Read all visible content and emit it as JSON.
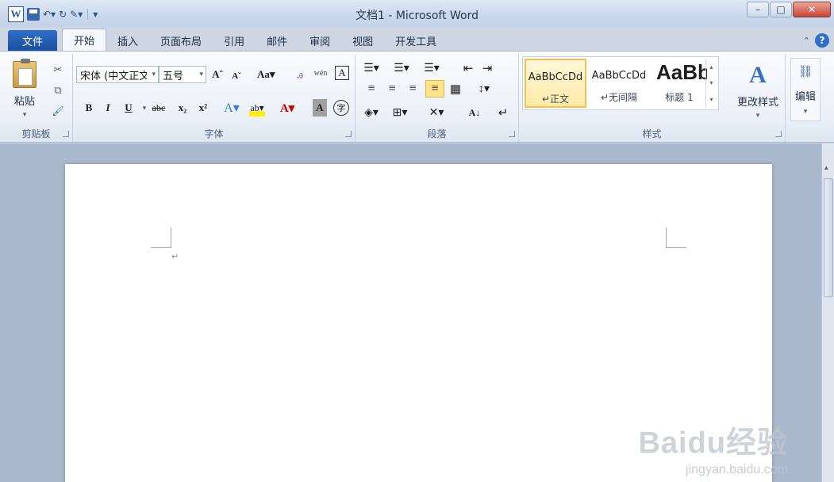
{
  "window": {
    "title": "文档1 - Microsoft Word",
    "minimize": "–",
    "maximize": "□",
    "close": "✕"
  },
  "qat": {
    "app_icon": "W",
    "undo": "↶▾",
    "redo": "↻",
    "format_painter": "✎▾",
    "customize": "▾"
  },
  "tabs": [
    {
      "label": "文件"
    },
    {
      "label": "开始"
    },
    {
      "label": "插入"
    },
    {
      "label": "页面布局"
    },
    {
      "label": "引用"
    },
    {
      "label": "邮件"
    },
    {
      "label": "审阅"
    },
    {
      "label": "视图"
    },
    {
      "label": "开发工具"
    }
  ],
  "ribbon": {
    "clipboard": {
      "label": "剪贴板",
      "paste": "粘贴",
      "paste_arrow": "▾",
      "cut_icon": "✂",
      "copy_icon": "⧉",
      "painter_icon": "🖌"
    },
    "font": {
      "label": "字体",
      "font_name": "宋体 (中文正文",
      "font_size": "五号",
      "grow": "Aˆ",
      "shrink": "Aˇ",
      "change_case": "Aa▾",
      "clear": "ꭿ",
      "phonetic": "wén",
      "border_char": "A",
      "bold": "B",
      "italic": "I",
      "underline": "U",
      "underline_arrow": "▾",
      "strike": "abc",
      "subscript": "x₂",
      "superscript": "x²",
      "effects": "A▾",
      "highlight": "ab▾",
      "font_color": "A▾",
      "shading_char": "A",
      "enclose": "字"
    },
    "paragraph": {
      "label": "段落",
      "bullets": "☰▾",
      "numbering": "☰▾",
      "multilevel": "☰▾",
      "decrease_indent": "⇤",
      "increase_indent": "⇥",
      "align_left": "≡",
      "center": "≡",
      "align_right": "≡",
      "justify": "≡",
      "distributed": "▦",
      "line_spacing": "↕▾",
      "shading": "◈▾",
      "borders": "⊞▾",
      "chinese_layout": "✕▾",
      "sort": "A↓",
      "show_marks": "↵"
    },
    "styles": {
      "label": "样式",
      "items": [
        {
          "preview": "AaBbCcDd",
          "name": "↵正文"
        },
        {
          "preview": "AaBbCcDd",
          "name": "↵无间隔"
        },
        {
          "preview": "AaBb",
          "name": "标题 1"
        }
      ],
      "change_styles": "更改样式",
      "change_arrow": "▾"
    },
    "editing": {
      "label": "编辑",
      "arrow": "▾"
    }
  },
  "document": {
    "paragraph_mark": "↵"
  },
  "watermark": {
    "main": "Baidu经验",
    "sub": "jingyan.baidu.com"
  }
}
